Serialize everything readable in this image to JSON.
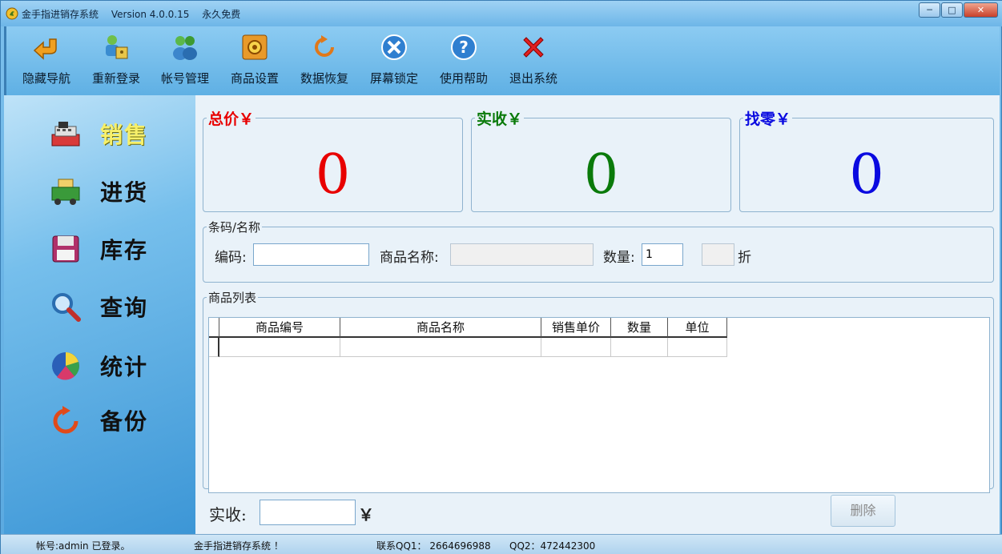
{
  "window": {
    "app_name": "金手指进销存系统",
    "version": "Version 4.0.0.15",
    "license": "永久免费",
    "min": "─",
    "max": "□",
    "close": "✕"
  },
  "toolbar": [
    {
      "label": "隐藏导航",
      "icon": "hide-nav-icon"
    },
    {
      "label": "重新登录",
      "icon": "relogin-icon"
    },
    {
      "label": "帐号管理",
      "icon": "accounts-icon"
    },
    {
      "label": "商品设置",
      "icon": "goods-settings-icon"
    },
    {
      "label": "数据恢复",
      "icon": "restore-icon"
    },
    {
      "label": "屏幕锁定",
      "icon": "lock-screen-icon"
    },
    {
      "label": "使用帮助",
      "icon": "help-icon"
    },
    {
      "label": "退出系统",
      "icon": "exit-icon"
    }
  ],
  "sidebar": {
    "items": [
      {
        "label": "销售",
        "icon": "cash-register-icon",
        "active": true
      },
      {
        "label": "进货",
        "icon": "truck-icon"
      },
      {
        "label": "库存",
        "icon": "floppy-disk-icon"
      },
      {
        "label": "查询",
        "icon": "magnifier-icon"
      },
      {
        "label": "统计",
        "icon": "pie-chart-icon"
      },
      {
        "label": "备份",
        "icon": "refresh-icon"
      }
    ]
  },
  "totals": {
    "total_label": "总价￥",
    "total_value": "0",
    "total_color": "#e80000",
    "received_label": "实收￥",
    "received_value": "0",
    "received_color": "#0a7a0a",
    "change_label": "找零￥",
    "change_value": "0",
    "change_color": "#0a0ae0"
  },
  "barcode": {
    "legend": "条码/名称",
    "code_label": "编码:",
    "code_value": "",
    "name_label": "商品名称:",
    "name_value": "",
    "qty_label": "数量:",
    "qty_value": "1",
    "discount_value": "",
    "discount_suffix": "折"
  },
  "product_list": {
    "legend": "商品列表",
    "columns": [
      "商品编号",
      "商品名称",
      "销售单价",
      "数量",
      "单位"
    ],
    "rows": []
  },
  "footer": {
    "received_label": "实收:",
    "received_value": "",
    "currency": "￥",
    "delete_label": "删除"
  },
  "status": {
    "account": "帐号:admin 已登录。",
    "app_msg": "金手指进销存系统 ！",
    "qq1": "联系QQ1： 2664696988",
    "qq2": "QQ2：472442300"
  }
}
